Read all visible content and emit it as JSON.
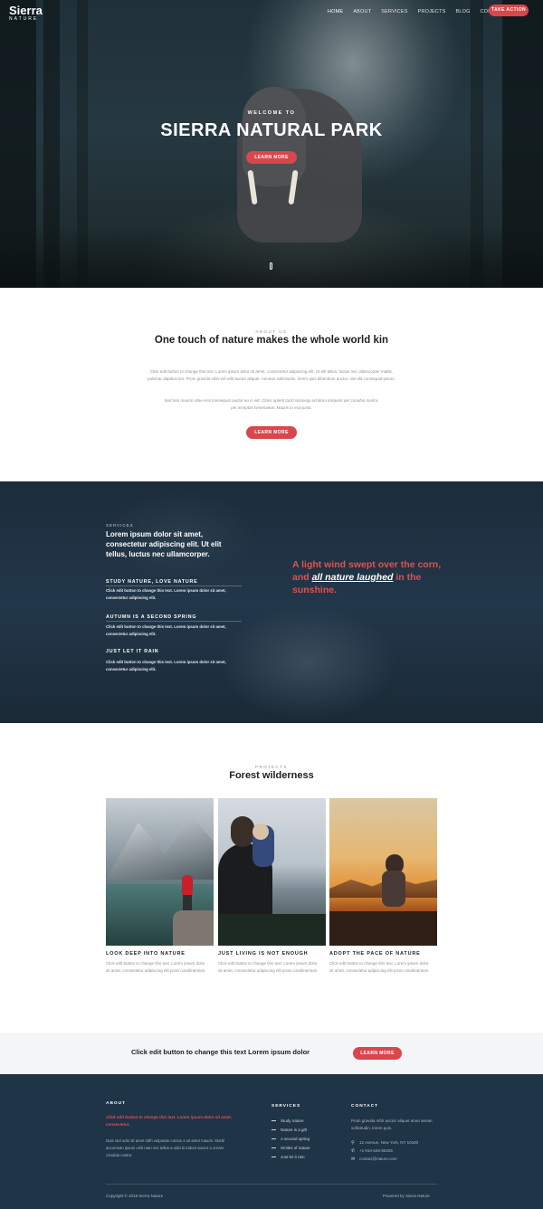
{
  "header": {
    "logo_title": "Sierra",
    "logo_subtitle": "NATURE",
    "nav": [
      "HOME",
      "ABOUT",
      "SERVICES",
      "PROJECTS",
      "BLOG",
      "CONTACT"
    ],
    "cta": "TAKE ACTION"
  },
  "hero": {
    "kicker": "WELCOME TO",
    "title": "SIERRA NATURAL PARK",
    "button": "LEARN MORE"
  },
  "about": {
    "label": "ABOUT US",
    "title": "One touch of nature makes the whole world kin",
    "p1": "Click edit button to change this text. Lorem ipsum dolor sit amet, consectetur adipiscing elit. Ut elit tellus, luctus nec ullamcorper mattis, pulvinar dapibus leo. Proin gravida nibh vel velit auctor aliquet. Aenean sollicitudin, lorem quis bibendum auctor, nisi elit consequat ipsum.",
    "p2": "Sed non mauris vitae erat consequat auctor eu in elit. Class aptent taciti sociosqu ad litora torquent per conubia nostra, per inceptos himenaeos. Mauris in erat justo.",
    "button": "LEARN MORE"
  },
  "services": {
    "label": "SERVICES",
    "heading": "Lorem ipsum dolor sit amet, consectetur adipiscing elit. Ut elit tellus, luctus nec ullamcorper.",
    "items": [
      {
        "title": "STUDY NATURE, LOVE NATURE",
        "text": "Click edit button to change this text. Lorem ipsum dolor sit amet, consectetur adipiscing elit."
      },
      {
        "title": "AUTUMN IS A SECOND SPRING",
        "text": "Click edit button to change this text. Lorem ipsum dolor sit amet, consectetur adipiscing elit."
      },
      {
        "title": "JUST LET IT RAIN",
        "text": "Click edit button to change this text. Lorem ipsum dolor sit amet, consectetur adipiscing elit."
      }
    ],
    "quote_part1": "A light wind swept over the corn, and ",
    "quote_emphasis": "all nature laughed",
    "quote_part2": " in the sunshine."
  },
  "projects": {
    "label": "PROJECTS",
    "title": "Forest wilderness",
    "cards": [
      {
        "title": "LOOK DEEP INTO NATURE",
        "text": "Click edit button to change this text. Lorem ipsum dolor sit amet, consectetur adipiscing elit proin condimentum."
      },
      {
        "title": "JUST LIVING IS NOT ENOUGH",
        "text": "Click edit button to change this text. Lorem ipsum dolor sit amet, consectetur adipiscing elit proin condimentum."
      },
      {
        "title": "ADOPT THE PACE OF NATURE",
        "text": "Click edit button to change this text. Lorem ipsum dolor sit amet, consectetur adipiscing elit proin condimentum."
      }
    ]
  },
  "cta_bar": {
    "text": "Click edit button to change this text Lorem ipsum dolor",
    "button": "LEARN MORE"
  },
  "footer": {
    "about_heading": "ABOUT",
    "about_highlight": "Click edit button to change this text. Lorem ipsum dolor sit amet, consectetur.",
    "about_text": "Duis sed odio sit amet nibh vulputate cursus a sit amet mauris. Morbi accumsan ipsum velit nam nec tellus a odio tincidunt auctor a ornare conubia nostra.",
    "services_heading": "SERVICES",
    "services_links": [
      "Study nature",
      "Nature is a gift",
      "A second spring",
      "Smiles of nature",
      "Just let it rain"
    ],
    "contact_heading": "CONTACT",
    "contact_text": "Proin gravida nibh auctor aliquet amet aenan sollicitudin, lorem quis.",
    "address": "12 Avenue, New York, NY 10160",
    "phone": "+1 910-626-85255",
    "email": "contact@nature.com",
    "copyright": "Copyright © 2018 Sierra Nature",
    "powered": "Powered by Sierra Nature"
  },
  "colors": {
    "accent": "#d9464c",
    "dark": "#1f3447"
  }
}
